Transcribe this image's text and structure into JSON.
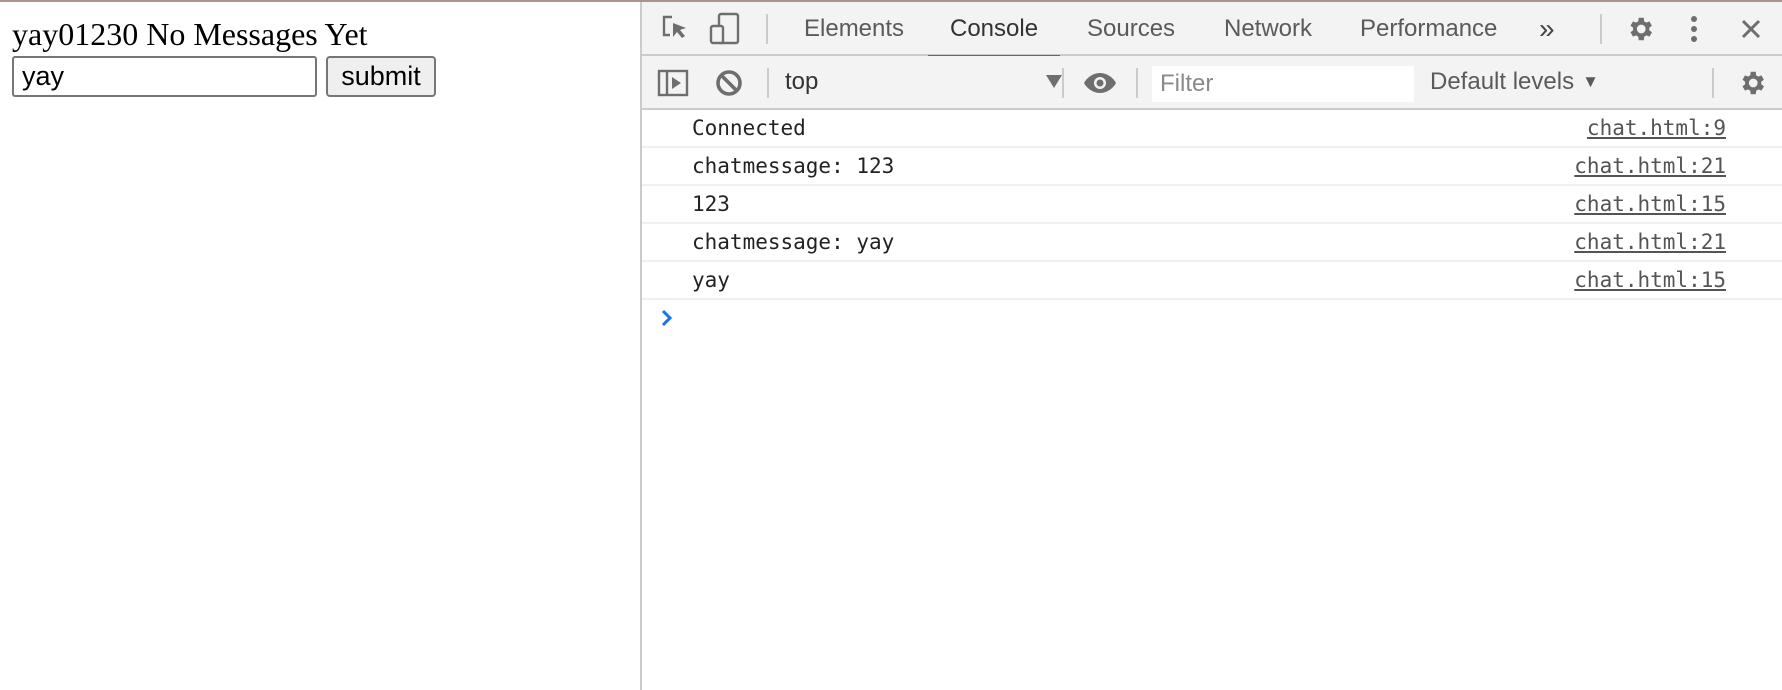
{
  "page": {
    "heading": "yay01230 No Messages Yet",
    "input_value": "yay",
    "submit_label": "submit"
  },
  "devtools": {
    "tabs": [
      {
        "label": "Elements",
        "active": false
      },
      {
        "label": "Console",
        "active": true
      },
      {
        "label": "Sources",
        "active": false
      },
      {
        "label": "Network",
        "active": false
      },
      {
        "label": "Performance",
        "active": false
      }
    ],
    "more_tabs_glyph": "»",
    "accent_color": "#1a73e8",
    "toolbar": {
      "context": "top",
      "filter_placeholder": "Filter",
      "filter_value": "",
      "levels_label": "Default levels"
    },
    "console": {
      "entries": [
        {
          "message": "Connected",
          "source": "chat.html:9"
        },
        {
          "message": "chatmessage: 123",
          "source": "chat.html:21"
        },
        {
          "message": "123",
          "source": "chat.html:15"
        },
        {
          "message": "chatmessage: yay",
          "source": "chat.html:21"
        },
        {
          "message": "yay",
          "source": "chat.html:15"
        }
      ]
    }
  }
}
